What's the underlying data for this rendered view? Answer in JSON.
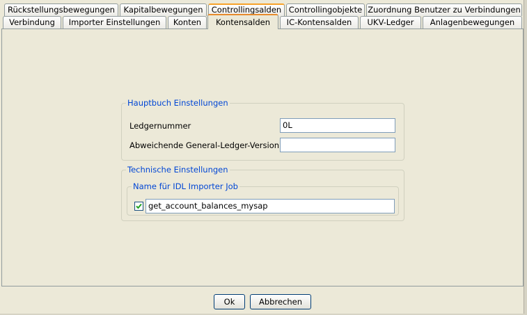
{
  "tabs": {
    "row1": [
      {
        "label": "Rückstellungsbewegungen"
      },
      {
        "label": "Kapitalbewegungen"
      },
      {
        "label": "Controllingsalden"
      },
      {
        "label": "Controllingobjekte"
      },
      {
        "label": "Zuordnung Benutzer zu Verbindungen"
      }
    ],
    "row2": [
      {
        "label": "Verbindung"
      },
      {
        "label": "Importer Einstellungen"
      },
      {
        "label": "Konten"
      },
      {
        "label": "Kontensalden"
      },
      {
        "label": "IC-Kontensalden"
      },
      {
        "label": "UKV-Ledger"
      },
      {
        "label": "Anlagenbewegungen"
      }
    ]
  },
  "hauptbuch": {
    "title": "Hauptbuch Einstellungen",
    "ledgernummer_label": "Ledgernummer",
    "ledgernummer_value": "0L",
    "gl_version_label": "Abweichende General-Ledger-Version",
    "gl_version_value": ""
  },
  "technisch": {
    "title": "Technische Einstellungen",
    "idl_group_title": "Name für IDL Importer Job",
    "job_checked": true,
    "job_name": "get_account_balances_mysap"
  },
  "buttons": {
    "ok": "Ok",
    "cancel": "Abbrechen"
  },
  "colors": {
    "accent": "#e68b2c",
    "legend": "#0046d5",
    "background": "#ece9d8"
  }
}
